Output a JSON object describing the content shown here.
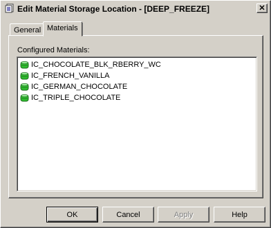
{
  "window": {
    "title": "Edit Material Storage Location - [DEEP_FREEZE]",
    "close_label": "✕"
  },
  "tabs": [
    {
      "label": "General",
      "active": false
    },
    {
      "label": "Materials",
      "active": true
    }
  ],
  "materials_panel": {
    "label": "Configured Materials:",
    "items": [
      {
        "name": "IC_CHOCOLATE_BLK_RBERRY_WC",
        "icon": "database-icon"
      },
      {
        "name": "IC_FRENCH_VANILLA",
        "icon": "database-icon"
      },
      {
        "name": "IC_GERMAN_CHOCOLATE",
        "icon": "database-icon"
      },
      {
        "name": "IC_TRIPLE_CHOCOLATE",
        "icon": "database-icon"
      }
    ]
  },
  "buttons": {
    "ok": "OK",
    "cancel": "Cancel",
    "apply": "Apply",
    "help": "Help"
  },
  "colors": {
    "face": "#d4d0c8",
    "icon_green": "#2fbf2f"
  }
}
